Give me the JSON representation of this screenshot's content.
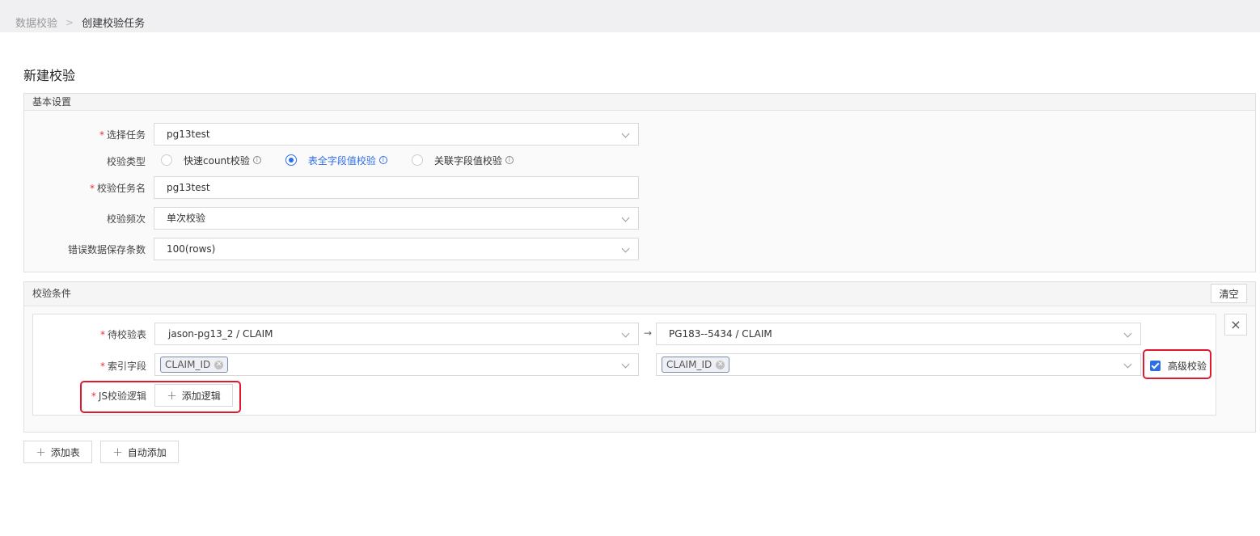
{
  "breadcrumb": {
    "parent": "数据校验",
    "separator": ">",
    "current": "创建校验任务"
  },
  "page_title": "新建校验",
  "basic": {
    "section_title": "基本设置",
    "task_label": "选择任务",
    "task_value": "pg13test",
    "type_label": "校验类型",
    "type_options": [
      "快速count校验",
      "表全字段值校验",
      "关联字段值校验"
    ],
    "type_selected": "表全字段值校验",
    "name_label": "校验任务名",
    "name_value": "pg13test",
    "freq_label": "校验频次",
    "freq_value": "单次校验",
    "errcount_label": "错误数据保存条数",
    "errcount_value": "100(rows)",
    "required_mark": "*",
    "info_icon": "ⓘ"
  },
  "conditions": {
    "section_title": "校验条件",
    "clear_label": "清空",
    "close_icon": "×",
    "table_label": "待校验表",
    "source_table": "jason-pg13_2 / CLAIM",
    "arrow": "→",
    "target_table": "PG183--5434 / CLAIM",
    "index_label": "索引字段",
    "source_index_tag": "CLAIM_ID",
    "target_index_tag": "CLAIM_ID",
    "advanced_label": "高级校验",
    "advanced_checked": true,
    "js_label": "JS校验逻辑",
    "add_logic_label": "添加逻辑"
  },
  "footer": {
    "add_table_label": "添加表",
    "auto_add_label": "自动添加"
  },
  "colors": {
    "accent": "#2d6ee6",
    "required": "#e5323e",
    "highlight_box": "#e0192f"
  }
}
